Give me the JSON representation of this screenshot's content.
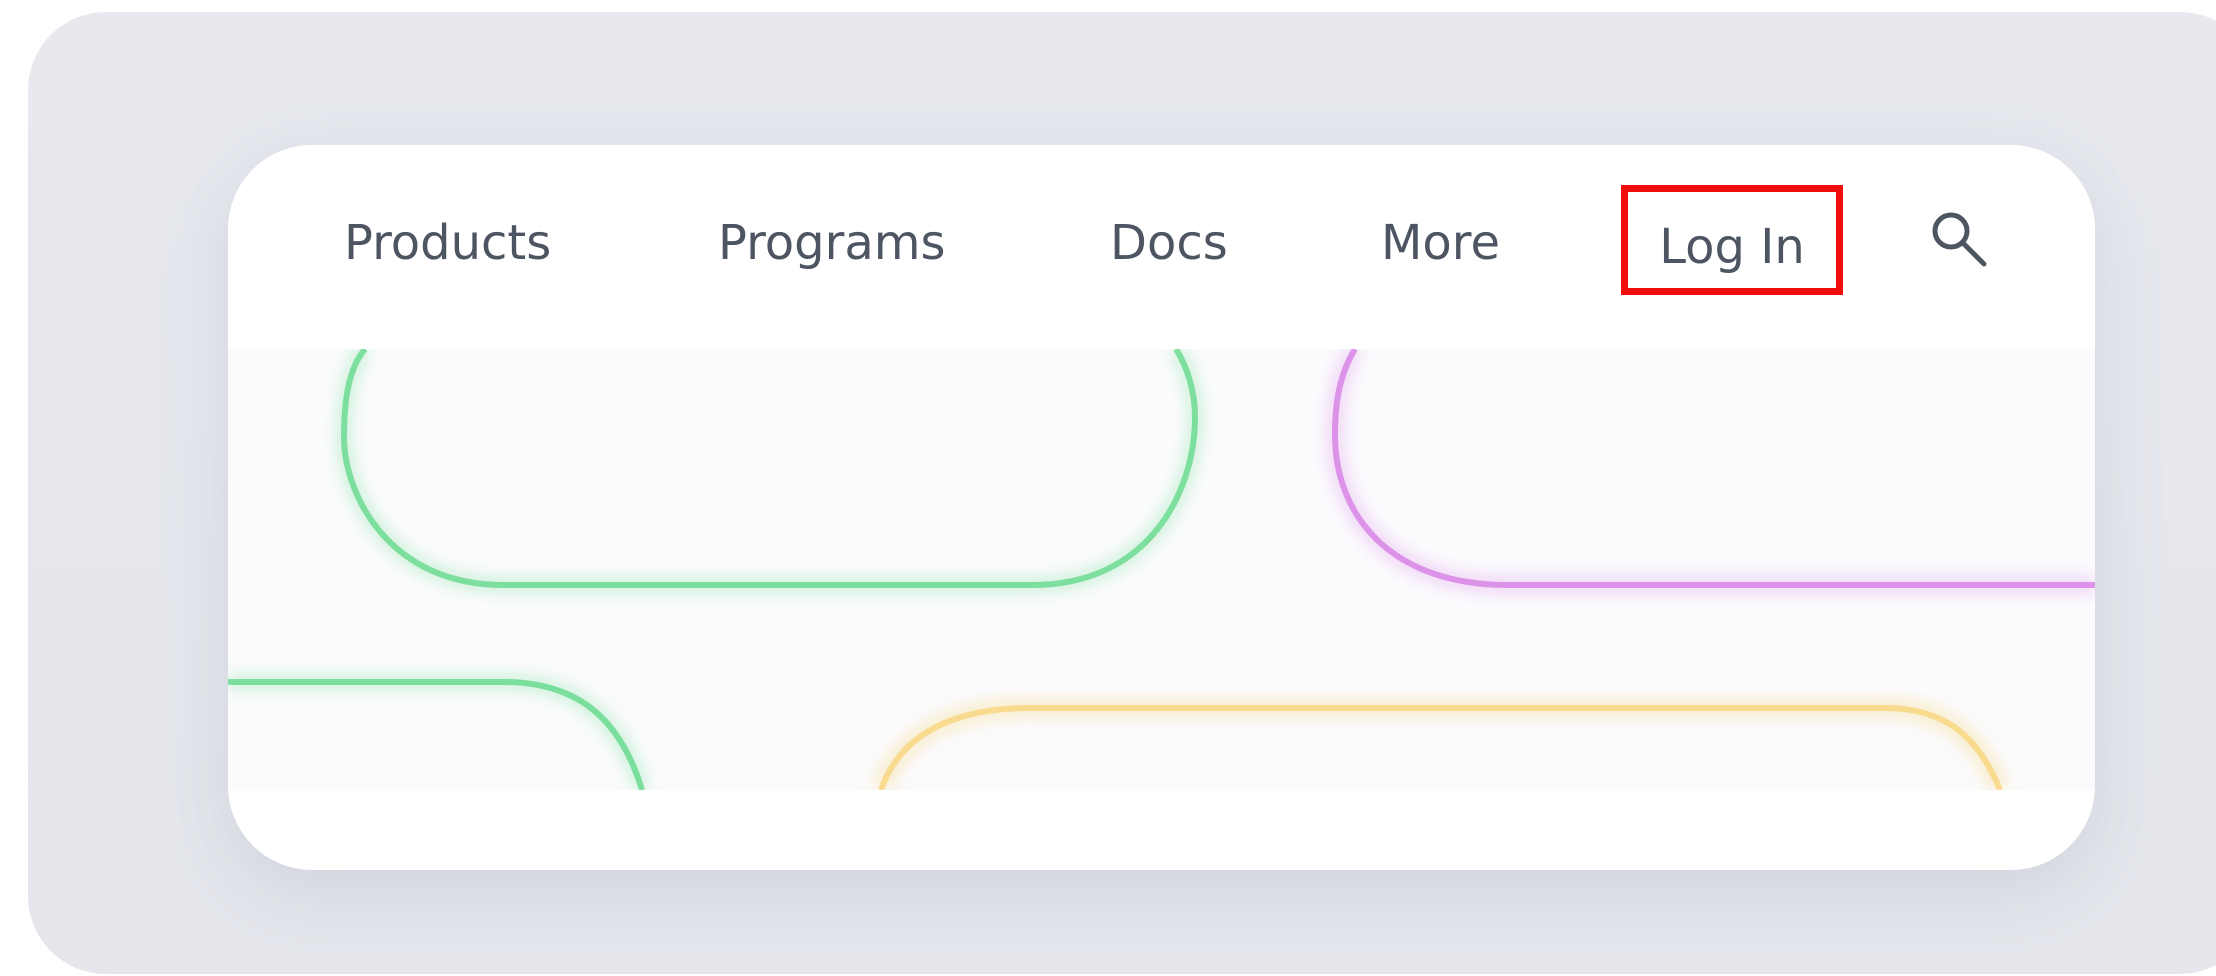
{
  "navigation": {
    "items": [
      {
        "label": "Products"
      },
      {
        "label": "Programs"
      },
      {
        "label": "Docs"
      },
      {
        "label": "More"
      }
    ],
    "login_label": "Log In",
    "search_icon": "search-icon"
  },
  "highlight": {
    "target": "login-link",
    "color": "#f20d0d"
  },
  "colors": {
    "text": "#4d5563",
    "shape_green": "#6fdc93",
    "shape_purple": "#d98ae7",
    "shape_yellow": "#f8d98a"
  }
}
